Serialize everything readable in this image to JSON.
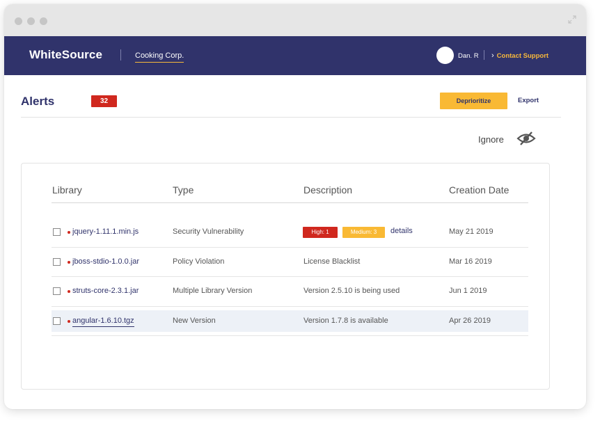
{
  "header": {
    "brand": "WhiteSource",
    "org": "Cooking Corp.",
    "user": "Dan. R",
    "support_link": "Contact Support"
  },
  "page": {
    "title": "Alerts",
    "alert_count": "32",
    "deprioritize_label": "Deprioritize",
    "export_label": "Export",
    "ignore_label": "Ignore"
  },
  "table": {
    "columns": [
      "Library",
      "Type",
      "Description",
      "Creation Date"
    ],
    "rows": [
      {
        "library": "jquery-1.11.1.min.js",
        "type": "Security Vulnerability",
        "description": "",
        "severity_high": "High: 1",
        "severity_medium": "Medium: 3",
        "details_link": "details",
        "date": "May 21 2019"
      },
      {
        "library": "jboss-stdio-1.0.0.jar",
        "type": "Policy Violation",
        "description": "License Blacklist",
        "date": "Mar 16 2019"
      },
      {
        "library": "struts-core-2.3.1.jar",
        "type": "Multiple Library Version",
        "description": "Version 2.5.10 is being used",
        "date": "Jun 1 2019"
      },
      {
        "library": "angular-1.6.10.tgz",
        "type": "New Version",
        "description": "Version 1.7.8 is available",
        "date": "Apr 26 2019"
      }
    ]
  },
  "icons": {
    "window_controls": "traffic-light-dots",
    "expand": "expand-icon",
    "ignore": "eye-slash-icon",
    "support_prefix": "chevron-right-icon"
  },
  "colors": {
    "nav_bg": "#30336b",
    "accent_yellow": "#f9b934",
    "alert_red": "#d0281e",
    "row_highlight": "#edf1f7"
  }
}
